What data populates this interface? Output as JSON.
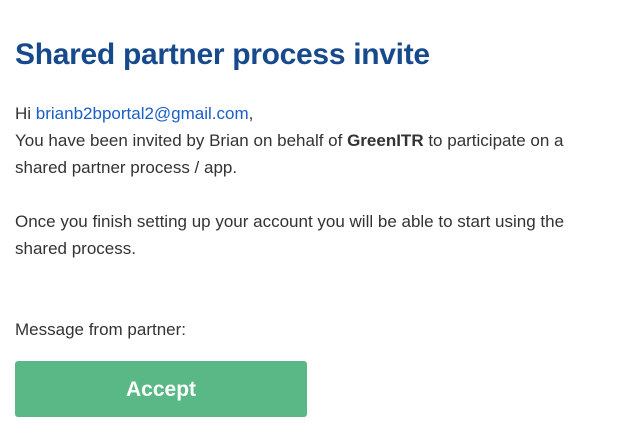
{
  "header": {
    "title": "Shared partner process invite"
  },
  "greeting": {
    "prefix": "Hi ",
    "email": "brianb2bportal2@gmail.com",
    "suffix": ","
  },
  "invite": {
    "text_before": "You have been invited by Brian on behalf of ",
    "company": "GreenITR",
    "text_after": " to participate on a shared partner process / app."
  },
  "setup_note": "Once you finish setting up your account you will be able to start using the shared process.",
  "message_label": "Message from partner:",
  "accept_button": {
    "label": "Accept"
  },
  "colors": {
    "title": "#174a8c",
    "link": "#1a5ec8",
    "accept_button_bg": "#5ab886",
    "text": "#333333"
  }
}
